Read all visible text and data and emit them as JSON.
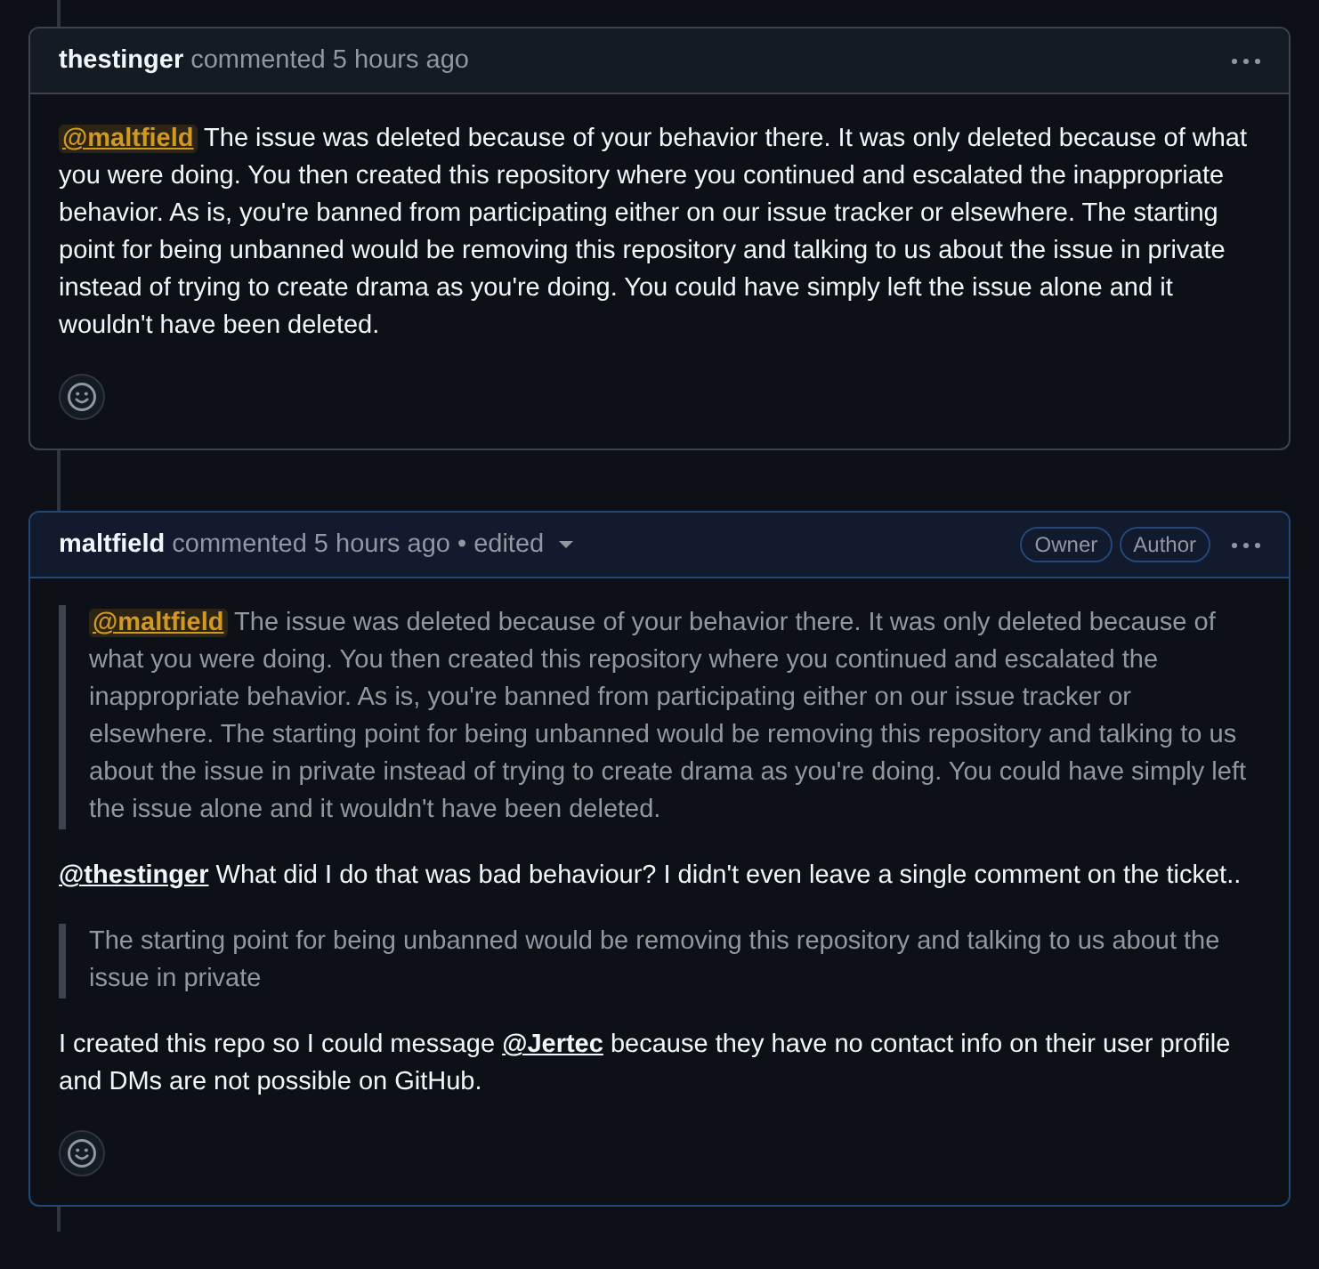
{
  "comments": [
    {
      "author": "thestinger",
      "timestamp": "commented 5 hours ago",
      "highlighted": false,
      "body": [
        {
          "kind": "paragraph",
          "parts": [
            {
              "kind": "mention",
              "text": "@maltfield",
              "self": true
            },
            {
              "kind": "text",
              "text": " The issue was deleted because of your behavior there. It was only deleted because of what you were doing. You then created this repository where you continued and escalated the inappropriate behavior. As is, you're banned from participating either on our issue tracker or elsewhere. The starting point for being unbanned would be removing this repository and talking to us about the issue in private instead of trying to create drama as you're doing. You could have simply left the issue alone and it wouldn't have been deleted."
            }
          ]
        }
      ]
    },
    {
      "author": "maltfield",
      "timestamp": "commented 5 hours ago",
      "edited": {
        "separator": "•",
        "label": "edited"
      },
      "highlighted": true,
      "badges": [
        "Owner",
        "Author"
      ],
      "body": [
        {
          "kind": "quote",
          "parts": [
            {
              "kind": "mention",
              "text": "@maltfield",
              "self": true
            },
            {
              "kind": "text",
              "text": " The issue was deleted because of your behavior there. It was only deleted because of what you were doing. You then created this repository where you continued and escalated the inappropriate behavior. As is, you're banned from participating either on our issue tracker or elsewhere. The starting point for being unbanned would be removing this repository and talking to us about the issue in private instead of trying to create drama as you're doing. You could have simply left the issue alone and it wouldn't have been deleted."
            }
          ]
        },
        {
          "kind": "paragraph",
          "parts": [
            {
              "kind": "mention",
              "text": "@thestinger",
              "self": false
            },
            {
              "kind": "text",
              "text": " What did I do that was bad behaviour? I didn't even leave a single comment on the ticket.."
            }
          ]
        },
        {
          "kind": "quote",
          "parts": [
            {
              "kind": "text",
              "text": "The starting point for being unbanned would be removing this repository and talking to us about the issue in private"
            }
          ]
        },
        {
          "kind": "paragraph",
          "parts": [
            {
              "kind": "text",
              "text": "I created this repo so I could message "
            },
            {
              "kind": "mention",
              "text": "@Jertec",
              "self": false
            },
            {
              "kind": "text",
              "text": " because they have no contact info on their user profile and DMs are not possible on GitHub."
            }
          ]
        }
      ]
    }
  ]
}
